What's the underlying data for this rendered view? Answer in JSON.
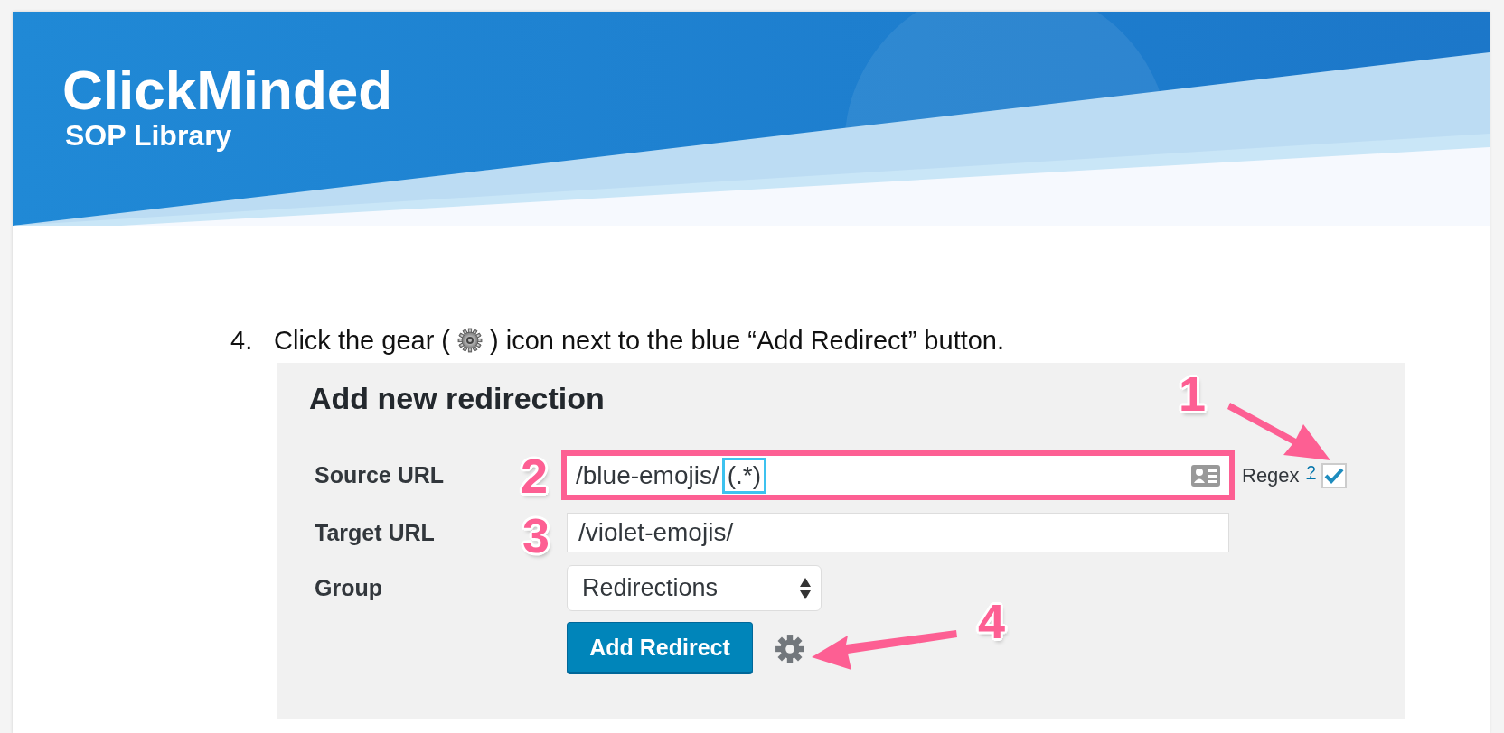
{
  "header": {
    "logo": "ClickMinded",
    "subtitle": "SOP Library"
  },
  "step": {
    "number": "4.",
    "text_before": "Click the gear (",
    "text_after": ") icon next to the blue “Add Redirect” button."
  },
  "screenshot": {
    "title": "Add new redirection",
    "fields": [
      {
        "kind": "text",
        "label": "Source URL",
        "value": "/blue-emojis/",
        "highlight": "(.*)",
        "outlined": true,
        "card_icon": true
      },
      {
        "kind": "text",
        "label": "Target URL",
        "value": "/violet-emojis/",
        "outlined": false
      },
      {
        "kind": "select",
        "label": "Group",
        "value": "Redirections"
      }
    ],
    "regex": {
      "label": "Regex",
      "help": "?",
      "checked": true
    },
    "button": "Add Redirect",
    "callouts": [
      {
        "label": "1"
      },
      {
        "label": "2"
      },
      {
        "label": "3"
      },
      {
        "label": "4"
      }
    ]
  }
}
